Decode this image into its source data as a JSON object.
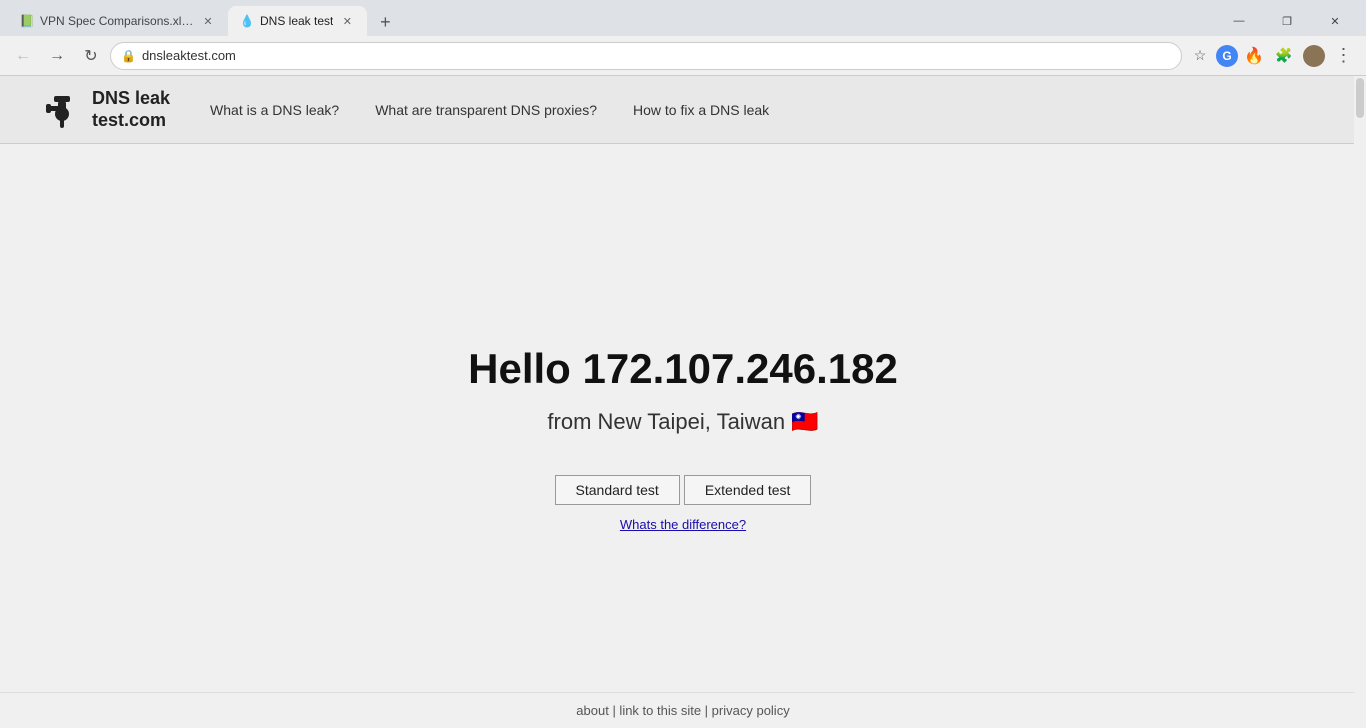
{
  "browser": {
    "tabs": [
      {
        "id": "tab1",
        "title": "VPN Spec Comparisons.xlsx - Go",
        "favicon": "📗",
        "active": false
      },
      {
        "id": "tab2",
        "title": "DNS leak test",
        "favicon": "💧",
        "active": true
      }
    ],
    "new_tab_label": "+",
    "window_controls": {
      "minimize": "—",
      "maximize": "❐",
      "close": "✕"
    },
    "toolbar": {
      "back_title": "←",
      "forward_title": "→",
      "reload_title": "↻",
      "address": "dnsleaktest.com",
      "bookmark_icon": "☆",
      "extensions_icon": "🧩",
      "profile_icon": "👤",
      "menu_icon": "⋮"
    }
  },
  "site": {
    "logo_text_line1": "DNS leak",
    "logo_text_line2": "test.com",
    "nav": {
      "link1": "What is a DNS leak?",
      "link2": "What are transparent DNS proxies?",
      "link3": "How to fix a DNS leak"
    },
    "main": {
      "hello_text": "Hello 172.107.246.182",
      "location_text": "from New Taipei, Taiwan 🇹🇼",
      "standard_test_btn": "Standard test",
      "extended_test_btn": "Extended test",
      "whats_diff_link": "Whats the difference?"
    },
    "footer": {
      "text": "about | link to this site | privacy policy"
    }
  }
}
